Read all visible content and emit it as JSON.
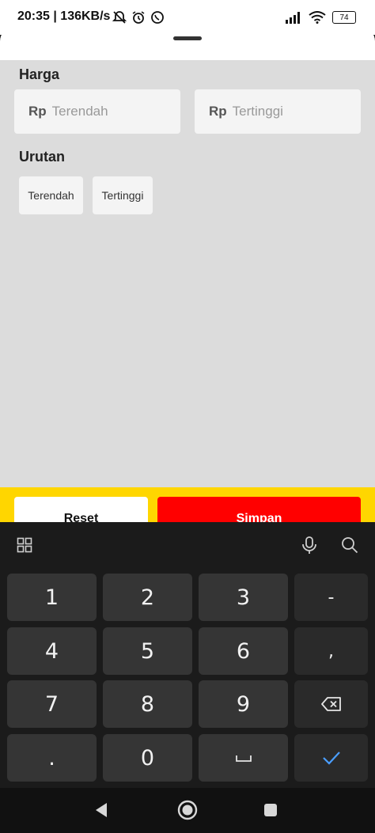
{
  "status": {
    "time": "20:35 | 136KB/s",
    "battery": "74"
  },
  "filter": {
    "price_label": "Harga",
    "min_prefix": "Rp",
    "min_placeholder": "Terendah",
    "max_prefix": "Rp",
    "max_placeholder": "Tertinggi",
    "sort_label": "Urutan",
    "sort_options": [
      "Terendah",
      "Tertinggi"
    ]
  },
  "actions": {
    "reset_label": "Reset",
    "save_label": "Simpan"
  },
  "keyboard": {
    "rows": [
      [
        "1",
        "2",
        "3",
        "-"
      ],
      [
        "4",
        "5",
        "6",
        ","
      ],
      [
        "7",
        "8",
        "9",
        "backspace"
      ],
      [
        ".",
        "0",
        "space",
        "done"
      ]
    ],
    "keys": {
      "k1": "1",
      "k2": "2",
      "k3": "3",
      "minus": "-",
      "k4": "4",
      "k5": "5",
      "k6": "6",
      "comma": ",",
      "k7": "7",
      "k8": "8",
      "k9": "9",
      "dot": ".",
      "k0": "0"
    }
  },
  "colors": {
    "accent_yellow": "#ffd600",
    "save_red": "#ff0000",
    "done_blue": "#4a9eff"
  },
  "icons": [
    "grid-icon",
    "mic-icon",
    "search-icon",
    "backspace-icon",
    "space-icon",
    "check-icon",
    "back-icon",
    "home-icon",
    "recents-icon"
  ]
}
